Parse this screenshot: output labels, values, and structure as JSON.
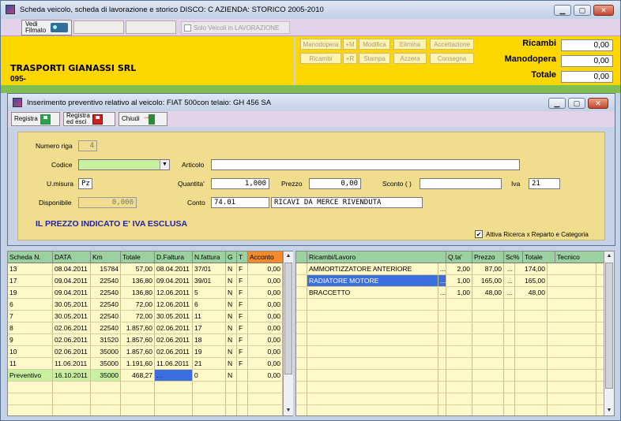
{
  "main_window": {
    "title": "Scheda veicolo, scheda di lavorazione e storico    DISCO: C    AZIENDA: STORICO 2005-2010",
    "buttons": {
      "min": "▁",
      "max": "▢",
      "close": "✕"
    }
  },
  "toolbar": {
    "vedi_filmato": "Vedi\nFilmato",
    "solo_veicoli": "Solo Veicoli in LAVORAZIONE"
  },
  "header": {
    "company": "TRASPORTI GIANASSI SRL",
    "code": "095-"
  },
  "action_buttons": [
    "Manodopera",
    "+M",
    "Modifica",
    "Elimina",
    "Accettazione",
    "Ricambi",
    "+R",
    "Stampa",
    "Azzera",
    "Consegna"
  ],
  "totals": {
    "ricambi_label": "Ricambi",
    "ricambi_value": "0,00",
    "manodopera_label": "Manodopera",
    "manodopera_value": "0,00",
    "totale_label": "Totale",
    "totale_value": "0,00"
  },
  "dialog": {
    "title": "Inserimento preventivo relativo al veicolo: FIAT  500con telaio: GH 456 SA",
    "registra": "Registra",
    "registra_esci": "Registra\ned esci",
    "chiudi": "Chiudi",
    "numero_riga_label": "Numero riga",
    "numero_riga": "4",
    "codice_label": "Codice",
    "codice": "",
    "articolo_label": "Articolo",
    "articolo": "",
    "umisura_label": "U.misura",
    "umisura": "Pz",
    "quantita_label": "Quantita'",
    "quantita": "1,000",
    "prezzo_label": "Prezzo",
    "prezzo": "0,00",
    "sconto_label": "Sconto ( )",
    "sconto": "",
    "iva_label": "Iva",
    "iva": "21",
    "disponibile_label": "Disponibile",
    "disponibile": "0,000",
    "conto_label": "Conto",
    "conto": "74.01",
    "conto_desc": "RICAVI DA MERCE RIVENDUTA",
    "note": "IL PREZZO INDICATO E' IVA ESCLUSA",
    "attiva_label": "Attiva Ricerca x Reparto e Categoria",
    "attiva_checked": "✔"
  },
  "left_table": {
    "headers": [
      "Scheda N.",
      "DATA",
      "Km",
      "Totale",
      "D.Faltura",
      "N.fattura",
      "G",
      "T",
      "Acconto"
    ],
    "rows": [
      [
        "13",
        "08.04.2011",
        "15784",
        "57,00",
        "08.04.2011",
        "37/01",
        "N",
        "F",
        "0,00"
      ],
      [
        "17",
        "09.04.2011",
        "22540",
        "136,80",
        "09.04.2011",
        "39/01",
        "N",
        "F",
        "0,00"
      ],
      [
        "19",
        "09.04.2011",
        "22540",
        "136,80",
        "12.06.2011",
        "5",
        "N",
        "F",
        "0,00"
      ],
      [
        "6",
        "30.05.2011",
        "22540",
        "72,00",
        "12.06.2011",
        "6",
        "N",
        "F",
        "0,00"
      ],
      [
        "7",
        "30.05.2011",
        "22540",
        "72,00",
        "30.05.2011",
        "11",
        "N",
        "F",
        "0,00"
      ],
      [
        "8",
        "02.06.2011",
        "22540",
        "1.857,60",
        "02.06.2011",
        "17",
        "N",
        "F",
        "0,00"
      ],
      [
        "9",
        "02.06.2011",
        "31520",
        "1.857,60",
        "02.06.2011",
        "18",
        "N",
        "F",
        "0,00"
      ],
      [
        "10",
        "02.06.2011",
        "35000",
        "1.857,60",
        "02.06.2011",
        "19",
        "N",
        "F",
        "0,00"
      ],
      [
        "11",
        "11.06.2011",
        "35000",
        "1.191,60",
        "11.06.2011",
        "21",
        "N",
        "F",
        "0,00"
      ],
      [
        "Preventivo",
        "16.10.2011",
        "35000",
        "468,27",
        ". .",
        "0",
        "N",
        "",
        "0,00"
      ]
    ]
  },
  "right_table": {
    "headers": [
      "Ricambi/Lavoro",
      "Q.ta'",
      "Prezzo",
      "Sc%",
      "Totale",
      "Tecnico"
    ],
    "rows": [
      [
        "AMMORTIZZATORE ANTERIORE",
        "...",
        "2,00",
        "87,00",
        "...",
        "174,00",
        ""
      ],
      [
        "RADIATORE MOTORE",
        "...",
        "1,00",
        "165,00",
        "...",
        "165,00",
        ""
      ],
      [
        "BRACCETTO",
        "...",
        "1,00",
        "48,00",
        "...",
        "48,00",
        ""
      ]
    ]
  },
  "colors": {
    "yellow": "#ffd700",
    "selected": "#3b6fe0",
    "preventivo": "#c8f0a0"
  }
}
